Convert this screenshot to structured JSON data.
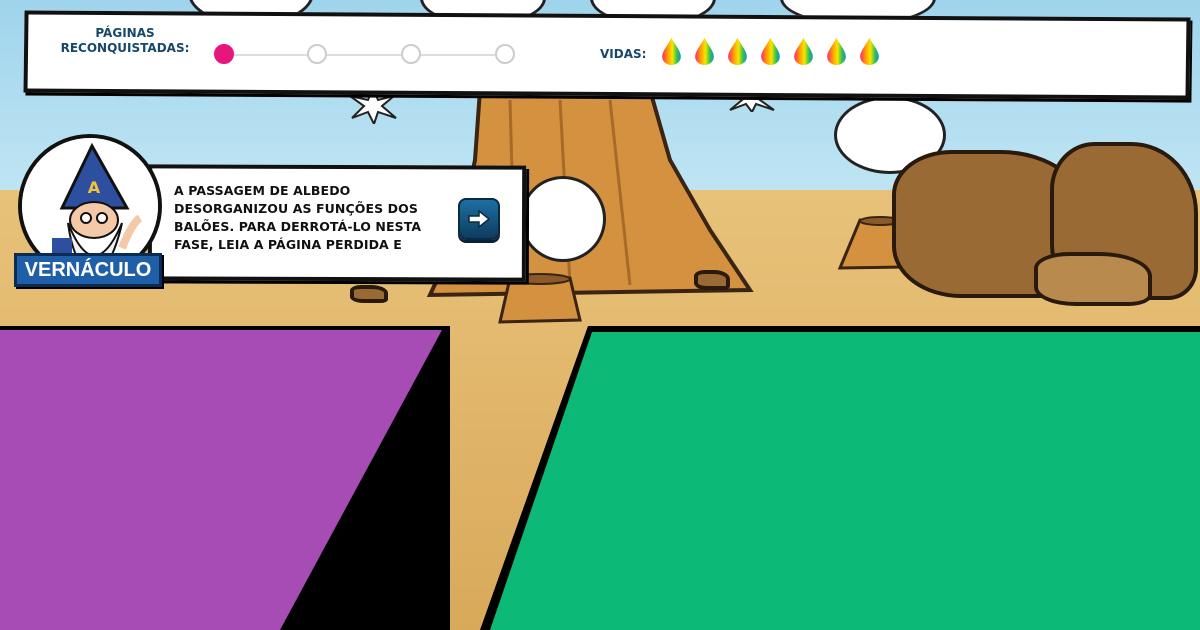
{
  "hud": {
    "pages_label": "PÁGINAS RECONQUISTADAS:",
    "pages_progress": {
      "total": 4,
      "completed": 1
    },
    "lives_label": "VIDAS:",
    "lives": 7
  },
  "dialog": {
    "speaker": "VERNÁCULO",
    "text": "A PASSAGEM DE ALBEDO DESORGANIZOU AS FUNÇÕES DOS BALÕES. PARA DERROTÁ-LO NESTA FASE, LEIA A PÁGINA PERDIDA E",
    "next_icon": "arrow-right-icon"
  },
  "colors": {
    "accent": "#e7167f",
    "hud_text": "#17486a",
    "panel_purple": "#a64cb4",
    "panel_green": "#0cb977",
    "name_plate": "#1f5fa8"
  }
}
